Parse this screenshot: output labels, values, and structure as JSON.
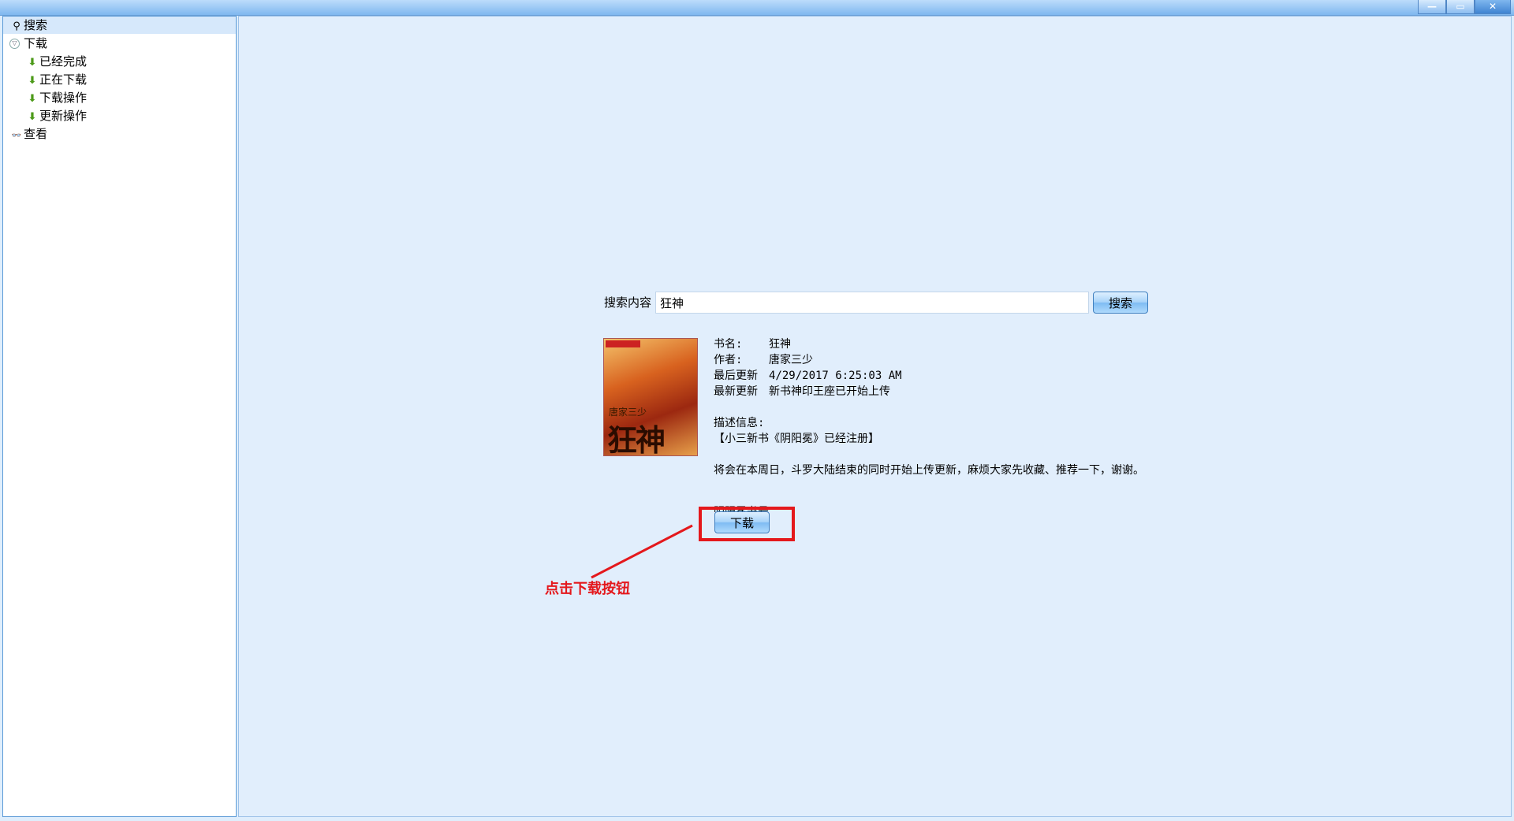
{
  "window": {
    "minimize_label": "—",
    "restore_label": "▭",
    "close_label": "✕"
  },
  "sidebar": {
    "items": [
      {
        "label": "搜索",
        "icon": "search-icon"
      },
      {
        "label": "下载",
        "icon": "collapse-icon"
      },
      {
        "label": "已经完成",
        "icon": "down-arrow-icon"
      },
      {
        "label": "正在下载",
        "icon": "down-arrow-icon"
      },
      {
        "label": "下载操作",
        "icon": "down-arrow-icon"
      },
      {
        "label": "更新操作",
        "icon": "down-arrow-icon"
      },
      {
        "label": "查看",
        "icon": "view-icon"
      }
    ]
  },
  "search": {
    "label": "搜索内容",
    "value": "狂神",
    "button_label": "搜索"
  },
  "book": {
    "cover_author": "唐家三少",
    "cover_title": "狂神",
    "name_key": "书名:",
    "name": "狂神",
    "author_key": "作者:",
    "author": "唐家三少",
    "last_update_key": "最后更新",
    "last_update": "4/29/2017 6:25:03 AM",
    "latest_key": "最新更新",
    "latest": "新书神印王座已开始上传",
    "desc_key": "描述信息:",
    "desc_line1": "【小三新书《阴阳冕》已经注册】",
    "desc_para": "将会在本周日，斗罗大陆结束的同时开始上传更新，麻烦大家先收藏、推荐一下，谢谢。",
    "desc_cut": "阴阳冕书号",
    "download_label": "下载"
  },
  "annotation": {
    "text": "点击下载按钮",
    "color": "#e4181c"
  }
}
